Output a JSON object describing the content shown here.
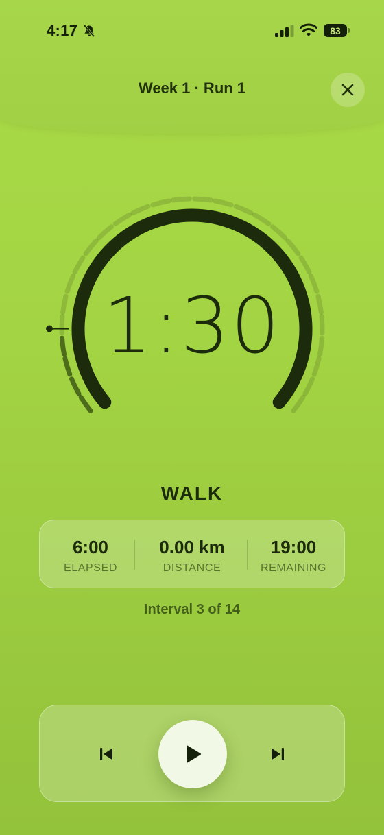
{
  "status_bar": {
    "time": "4:17",
    "battery": "83",
    "icons": [
      "bell-slash-icon",
      "signal-icon",
      "wifi-icon",
      "battery-icon"
    ]
  },
  "header": {
    "title": "Week 1 · Run 1",
    "close_icon": "close-icon"
  },
  "timer": {
    "display": "1:30",
    "phase": "WALK",
    "phase_progress": 0
  },
  "stats": [
    {
      "value": "6:00",
      "label": "ELAPSED"
    },
    {
      "value": "0.00 km",
      "label": "DISTANCE"
    },
    {
      "value": "19:00",
      "label": "REMAINING"
    }
  ],
  "interval": {
    "text": "Interval 3 of 14",
    "current": 3,
    "total": 14
  },
  "controls": {
    "prev_icon": "skip-previous-icon",
    "play_icon": "play-icon",
    "next_icon": "skip-next-icon"
  },
  "colors": {
    "background_top": "#a9da47",
    "background_bottom": "#93c23b",
    "dark": "#1c2b0b",
    "play_button": "#f2f8e6"
  }
}
